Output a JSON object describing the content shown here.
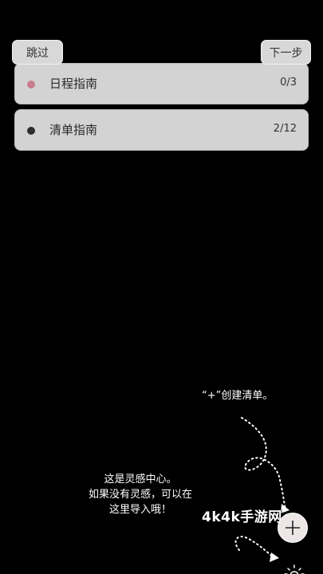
{
  "top_bar": {
    "skip_label": "跳过",
    "next_label": "下一步"
  },
  "guides": [
    {
      "label": "日程指南",
      "count": "0/3",
      "dot_color": "#c87d8e"
    },
    {
      "label": "清单指南",
      "count": "2/12",
      "dot_color": "#2e2e2e"
    }
  ],
  "hints": {
    "create": "“+”创建清单。",
    "inspiration_lines": [
      "这是灵感中心。",
      "如果没有灵感，可以在",
      "这里导入哦！"
    ]
  },
  "watermark": "4k4k手游网",
  "icons": {
    "fab": "plus-icon",
    "bottom": "sun-icon"
  },
  "colors": {
    "background": "#000000",
    "card": "#d3d3d3",
    "fab": "#ece6e6"
  }
}
